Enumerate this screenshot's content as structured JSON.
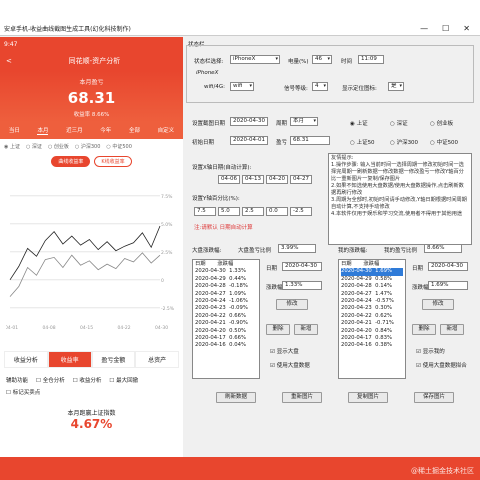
{
  "window": {
    "title": "安卓手机-收益曲线截图生成工具(幻化科技制作)",
    "min": "—",
    "max": "☐",
    "close": "✕"
  },
  "phone": {
    "status_time": "9:47",
    "header_title": "同花顺-资产分析",
    "hero_label": "本月盈亏",
    "hero_value": "68.31",
    "hero_sub": "收益率 8.66%",
    "tabs": [
      "当日",
      "本月",
      "近三月",
      "今年",
      "全部",
      "自定义"
    ],
    "active_tab": 1,
    "compare_options": [
      "上证",
      "深证",
      "创业板",
      "沪深300",
      "中证500"
    ],
    "pills": [
      "曲线收益率",
      "K线收益率"
    ],
    "chart_data": {
      "type": "line",
      "x_ticks": [
        "04-01",
        "04-08",
        "04-15",
        "04-22",
        "04-30"
      ],
      "y_ticks": [
        "7.5%",
        "5.0%",
        "2.5%",
        "0",
        "-2.5%"
      ],
      "ylim": [
        -3.5,
        9
      ],
      "series": [
        {
          "color": "#222222",
          "values": [
            0,
            1.2,
            2.8,
            2.1,
            3.5,
            4.3,
            3.2,
            3.9,
            3.1,
            3.6,
            2.7,
            3.4,
            2.6,
            3.0,
            3.3,
            4.2,
            2.9,
            4.8
          ]
        },
        {
          "color": "#888888",
          "values": [
            -1.5,
            -0.6,
            1.1,
            0.4,
            1.8,
            2.0,
            1.1,
            2.2,
            1.3,
            1.7,
            0.9,
            1.4,
            1.0,
            1.9,
            1.6,
            2.4,
            1.5,
            2.2
          ]
        }
      ]
    },
    "seg": [
      "收益分析",
      "收益率",
      "盈亏金额",
      "总资产"
    ],
    "checks": [
      "辅助功能",
      "全仓分析",
      "收益分析",
      "最大回撤",
      "标记买卖点"
    ],
    "bottom_label": "本月跑赢上证指数",
    "bottom_value": "4.67%"
  },
  "form": {
    "status_group": "状态栏",
    "status_select_label": "状态栏选择:",
    "status_select": "iPhoneX",
    "battery_label": "电量(%)",
    "battery": "46",
    "time_label": "时间",
    "time": "11:09",
    "phone_model": "iPhoneX",
    "wifi_label": "wifi/4G:",
    "wifi": "wifi",
    "signal_label": "信号等级:",
    "signal": "4",
    "show_loc_label": "显示定位图标:",
    "show_loc": "是",
    "screenshot_date_label": "设置截图日期",
    "screenshot_date": "2020-04-30",
    "period_label": "周期",
    "period": "本月",
    "index_opts": [
      "上证",
      "深证",
      "创业板",
      "上证50",
      "沪深300",
      "中证500"
    ],
    "init_date_label": "初始日期",
    "init_date": "2020-04-01",
    "profit_label": "盈亏",
    "profit": "68.31",
    "x_axis_label": "设置X轴日期(自动计算):",
    "x_dates": [
      "04-01",
      "04-06",
      "04-13",
      "04-20",
      "04-27"
    ],
    "y_axis_label": "设置Y轴百分比(%):",
    "y_values": [
      "7.5",
      "5.0",
      "2.5",
      "0.0",
      "-2.5"
    ],
    "hint_red": "注:请默认 日期自动计算",
    "help_title": "友情提示:",
    "help_text": "1.操作步骤: 输入当前时间一选择周期一修改初始时间一选择完周期一刷新数据一修改数据一修改盈亏一修改Y轴百分比一重新图片一复制/保存图片\n2.如果不知选使用大盘数据/使用大盘数据操作,点击刷新数据再刷行修改\n3.周期为全部时,初始时间请手动修改,Y轴日期根据时间周期自动计算,不支持手动修改\n4.本软件仅用于娱乐和学习交流,使用者不得用于其他用途",
    "left": {
      "rate_label": "大盘涨跌幅:",
      "profit_ratio_label": "大盘盈亏比例",
      "profit_ratio": "3.99%",
      "table_header": "日期       涨跌幅",
      "rows": [
        "2020-04-30  1.33%",
        "2020-04-29  0.44%",
        "2020-04-28  -0.18%",
        "2020-04-27  1.09%",
        "2020-04-24  -1.06%",
        "2020-04-23  -0.09%",
        "2020-04-22  0.66%",
        "2020-04-21  -0.90%",
        "2020-04-20  0.50%",
        "2020-04-17  0.66%",
        "2020-04-16  0.04%"
      ],
      "date_label": "日期",
      "date": "2020-04-30",
      "rate_field_label": "涨跌幅",
      "rate": "1.33%",
      "modify": "修改",
      "delete": "删除",
      "add": "新增",
      "show_big": "显示大盘",
      "use_data": "使用大盘数据"
    },
    "right": {
      "rate_label": "我的涨跌幅:",
      "profit_ratio_label": "我的盈亏比例",
      "profit_ratio": "8.66%",
      "table_header": "日期       涨跌幅",
      "rows": [
        "2020-04-30  1.69%",
        "2020-04-29  0.58%",
        "2020-04-28  0.14%",
        "2020-04-27  1.47%",
        "2020-04-24  -0.57%",
        "2020-04-23  0.30%",
        "2020-04-22  0.62%",
        "2020-04-21  -0.71%",
        "2020-04-20  0.84%",
        "2020-04-17  0.83%",
        "2020-04-16  0.38%"
      ],
      "date_label": "日期",
      "date": "2020-04-30",
      "rate_field_label": "涨跌幅",
      "rate": "1.69%",
      "modify": "修改",
      "delete": "删除",
      "add": "新增",
      "show_mine": "显示我的",
      "use_data": "使用大盘数据拟合"
    },
    "buttons": [
      "刷新数据",
      "重新图片",
      "复制图片",
      "保存图片"
    ]
  },
  "watermark": "@稀土掘金技术社区"
}
